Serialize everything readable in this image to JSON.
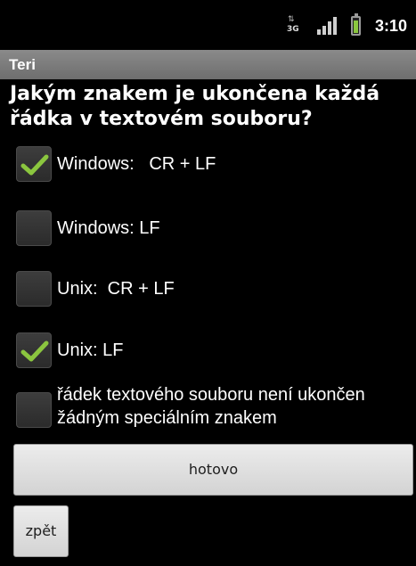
{
  "status_bar": {
    "network_label": "3G",
    "time": "3:10",
    "battery_color": "#8bc63f"
  },
  "title_bar": {
    "title": "Teri"
  },
  "question": {
    "text": "Jakým znakem je ukončena každá řádka v textovém souboru?"
  },
  "options": [
    {
      "label": "Windows:   CR + LF",
      "checked": true
    },
    {
      "label": "Windows: LF",
      "checked": false
    },
    {
      "label": "Unix:  CR + LF",
      "checked": false
    },
    {
      "label": "Unix: LF",
      "checked": true
    },
    {
      "label": "řádek textového souboru není ukončen\nžádným speciálním znakem",
      "checked": false
    }
  ],
  "buttons": {
    "done_label": "hotovo",
    "back_label": "zpět"
  },
  "colors": {
    "check_mark": "#8bc63f",
    "title_bar": "#7a7a7a",
    "background": "#000000"
  },
  "icons": {
    "network": "network-3g-icon",
    "signal": "signal-strength-icon",
    "battery": "battery-icon",
    "check": "checkmark-icon"
  }
}
